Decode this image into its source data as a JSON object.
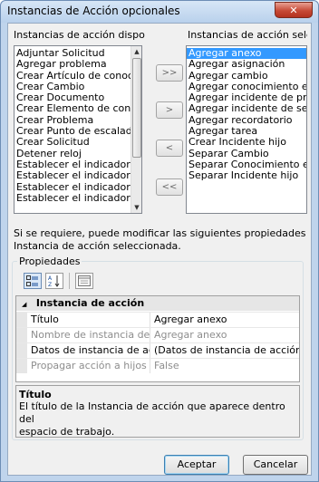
{
  "window": {
    "title": "Instancias de Acción opcionales",
    "close_symbol": "✕"
  },
  "available": {
    "label": "Instancias de acción disponibles",
    "items": [
      "Adjuntar Solicitud",
      "Agregar problema",
      "Crear Artículo de conocimiento",
      "Crear Cambio",
      "Crear Documento",
      "Crear Elemento de configuración",
      "Crear Problema",
      "Crear Punto de escalado",
      "Crear Solicitud",
      "Detener reloj",
      "Establecer el indicador de",
      "Establecer el indicador de",
      "Establecer el indicador de",
      "Establecer el indicador de"
    ],
    "scroll_up": "▲",
    "scroll_down": "▼"
  },
  "selected_list": {
    "label": "Instancias de acción seleccionadas",
    "items": [
      "Agregar anexo",
      "Agregar asignación",
      "Agregar cambio",
      "Agregar conocimiento enlazado",
      "Agregar incidente de principal",
      "Agregar incidente de secundario",
      "Agregar recordatorio",
      "Agregar tarea",
      "Crear Incidente hijo",
      "Separar Cambio",
      "Separar Conocimiento enlazado",
      "Separar Incidente hijo"
    ],
    "selected_index": 0
  },
  "move_buttons": {
    "add_all": ">>",
    "add": ">",
    "remove": "<",
    "remove_all": "<<"
  },
  "info_text_line1": "Si se requiere, puede modificar las siguientes propiedades de la",
  "info_text_line2": "Instancia de acción seleccionada.",
  "properties": {
    "group_label": "Propiedades",
    "category": "Instancia de acción",
    "category_expander": "◢",
    "toolbar": {
      "categorized_icon": "categorized-view-icon",
      "alphabetical_icon": "alphabetical-sort-icon",
      "property_pages_icon": "property-pages-icon"
    },
    "rows": [
      {
        "name": "Título",
        "value": "Agregar anexo",
        "disabled": false
      },
      {
        "name": "Nombre de instancia de acción",
        "value": "Agregar anexo",
        "disabled": true
      },
      {
        "name": "Datos de instancia de acción",
        "value": "(Datos de instancia de acción)",
        "disabled": false
      },
      {
        "name": "Propagar acción a hijos",
        "value": "False",
        "disabled": true
      }
    ],
    "description_title": "Título",
    "description_line1": "El título de la Instancia de acción que aparece dentro del",
    "description_line2": "espacio de trabajo."
  },
  "buttons": {
    "accept": "Aceptar",
    "cancel": "Cancelar"
  }
}
